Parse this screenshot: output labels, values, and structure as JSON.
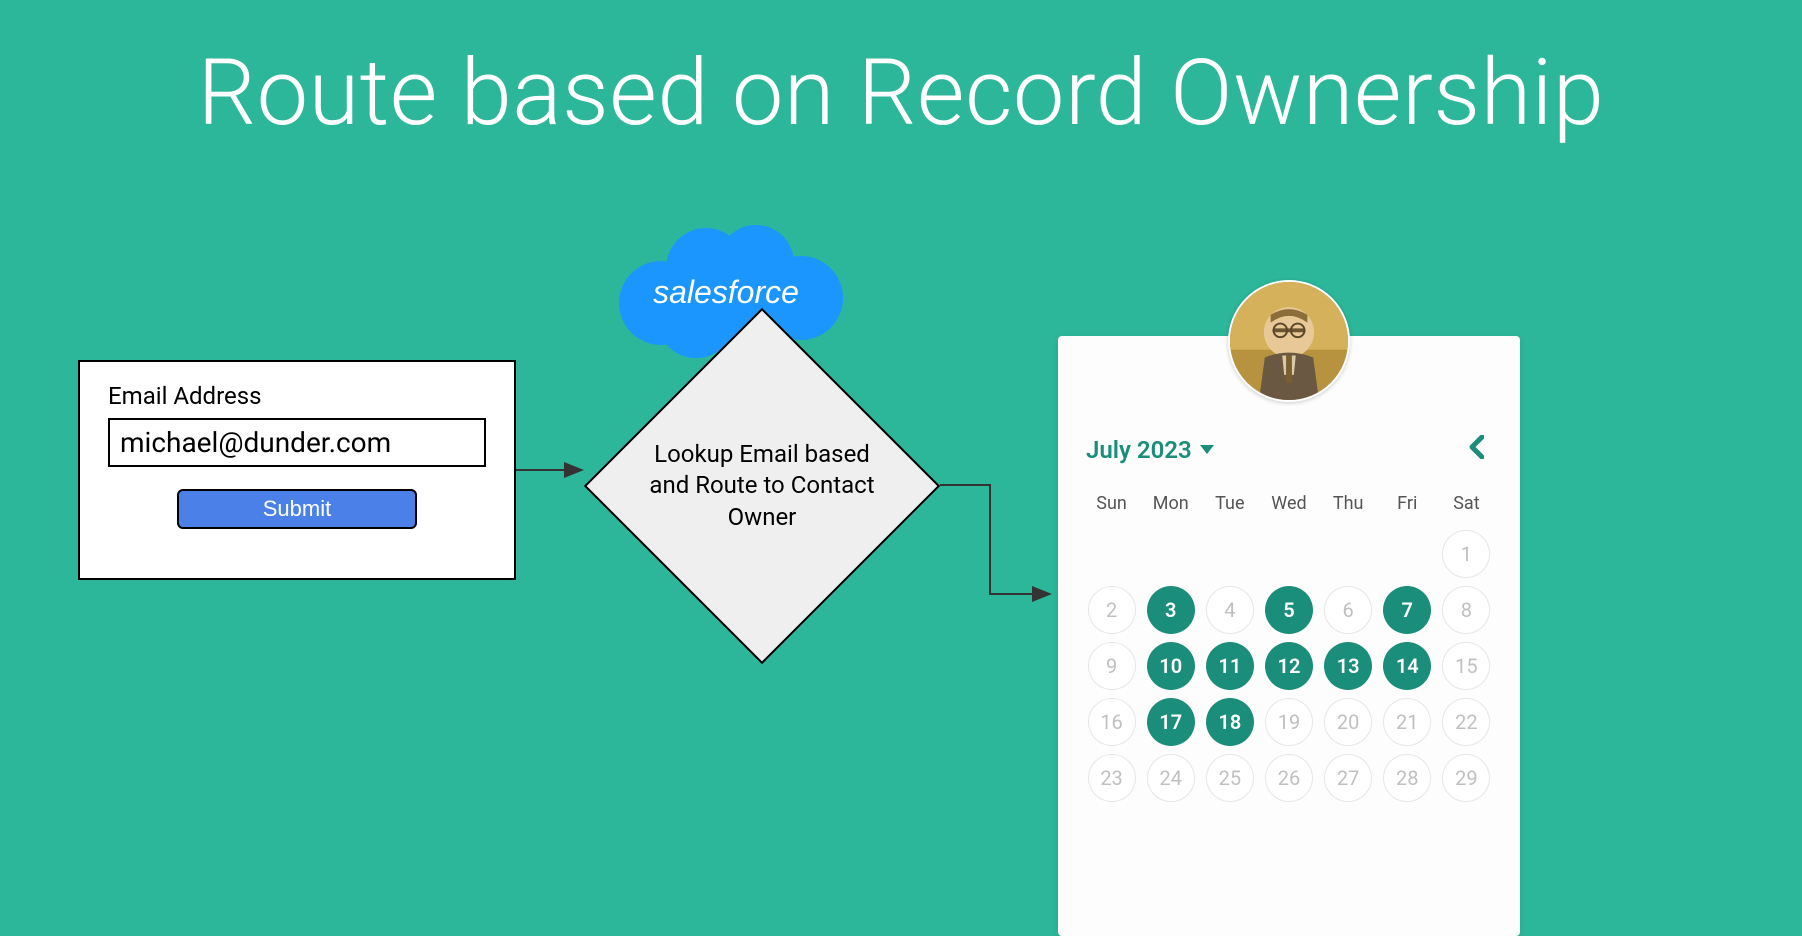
{
  "title": "Route based on Record Ownership",
  "form": {
    "label": "Email Address",
    "email_value": "michael@dunder.com",
    "submit_label": "Submit"
  },
  "cloud": {
    "brand": "salesforce"
  },
  "decision": {
    "text": "Lookup Email based and Route to Contact Owner"
  },
  "calendar": {
    "month_label": "July 2023",
    "weekdays": [
      "Sun",
      "Mon",
      "Tue",
      "Wed",
      "Thu",
      "Fri",
      "Sat"
    ],
    "days": [
      {
        "n": "",
        "state": "empty"
      },
      {
        "n": "",
        "state": "empty"
      },
      {
        "n": "",
        "state": "empty"
      },
      {
        "n": "",
        "state": "empty"
      },
      {
        "n": "",
        "state": "empty"
      },
      {
        "n": "",
        "state": "empty"
      },
      {
        "n": "1",
        "state": "inactive"
      },
      {
        "n": "2",
        "state": "inactive"
      },
      {
        "n": "3",
        "state": "active"
      },
      {
        "n": "4",
        "state": "inactive"
      },
      {
        "n": "5",
        "state": "active"
      },
      {
        "n": "6",
        "state": "inactive"
      },
      {
        "n": "7",
        "state": "active"
      },
      {
        "n": "8",
        "state": "inactive"
      },
      {
        "n": "9",
        "state": "inactive"
      },
      {
        "n": "10",
        "state": "active"
      },
      {
        "n": "11",
        "state": "active"
      },
      {
        "n": "12",
        "state": "active"
      },
      {
        "n": "13",
        "state": "active"
      },
      {
        "n": "14",
        "state": "active"
      },
      {
        "n": "15",
        "state": "inactive"
      },
      {
        "n": "16",
        "state": "inactive"
      },
      {
        "n": "17",
        "state": "active"
      },
      {
        "n": "18",
        "state": "active"
      },
      {
        "n": "19",
        "state": "inactive"
      },
      {
        "n": "20",
        "state": "inactive"
      },
      {
        "n": "21",
        "state": "inactive"
      },
      {
        "n": "22",
        "state": "inactive"
      },
      {
        "n": "23",
        "state": "inactive"
      },
      {
        "n": "24",
        "state": "inactive"
      },
      {
        "n": "25",
        "state": "inactive"
      },
      {
        "n": "26",
        "state": "inactive"
      },
      {
        "n": "27",
        "state": "inactive"
      },
      {
        "n": "28",
        "state": "inactive"
      },
      {
        "n": "29",
        "state": "inactive"
      }
    ]
  },
  "colors": {
    "bg": "#2cb79a",
    "accent": "#1a8e7a",
    "cloud": "#1b96ff",
    "button": "#4a80e8"
  }
}
